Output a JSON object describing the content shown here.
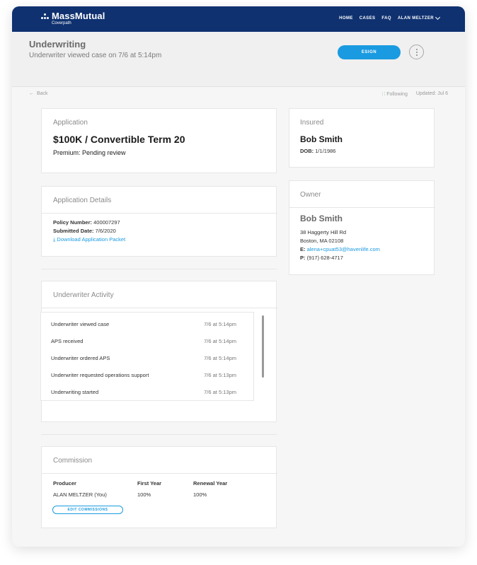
{
  "nav": {
    "logo": "MassMutual",
    "logo_sub": "Coverpath",
    "links": [
      "HOME",
      "CASES",
      "FAQ"
    ],
    "user": "ALAN MELTZER"
  },
  "header": {
    "title": "Underwriting",
    "subtitle": "Underwriter viewed case on 7/6 at 5:14pm",
    "esign_label": "ESIGN",
    "accent_color": "#1a9ae0",
    "nav_color": "#0f3170"
  },
  "meta": {
    "back_label": "Back",
    "following_label": "Following",
    "updated_label": "Updated: Jul 6"
  },
  "application": {
    "label": "Application",
    "product": "$100K / Convertible Term 20",
    "premium": "Premium: Pending review"
  },
  "application_details": {
    "label": "Application Details",
    "policy_number_label": "Policy Number:",
    "policy_number": "400007297",
    "submitted_date_label": "Submitted Date:",
    "submitted_date": "7/6/2020",
    "download_label": "Download Application Packet"
  },
  "underwriter_activity": {
    "label": "Underwriter Activity",
    "items": [
      {
        "event": "Underwriter viewed case",
        "time": "7/6 at 5:14pm"
      },
      {
        "event": "APS received",
        "time": "7/6 at 5:14pm"
      },
      {
        "event": "Underwriter ordered APS",
        "time": "7/6 at 5:14pm"
      },
      {
        "event": "Underwriter requested operations support",
        "time": "7/6 at 5:13pm"
      },
      {
        "event": "Underwriting started",
        "time": "7/6 at 5:13pm"
      }
    ]
  },
  "commission": {
    "label": "Commission",
    "columns": [
      "Producer",
      "First Year",
      "Renewal Year"
    ],
    "rows": [
      {
        "producer": "ALAN MELTZER (You)",
        "first_year": "100%",
        "renewal_year": "100%"
      }
    ],
    "edit_label": "EDIT COMMISSIONS"
  },
  "insured": {
    "label": "Insured",
    "name": "Bob Smith",
    "dob_label": "DOB:",
    "dob": "1/1/1986"
  },
  "owner": {
    "label": "Owner",
    "name": "Bob Smith",
    "address1": "38 Haggerty Hill Rd",
    "address2": "Boston, MA 02108",
    "email_label": "E:",
    "email": "alena+cpuat53@havenlife.com",
    "phone_label": "P:",
    "phone": "(917) 628-4717"
  }
}
